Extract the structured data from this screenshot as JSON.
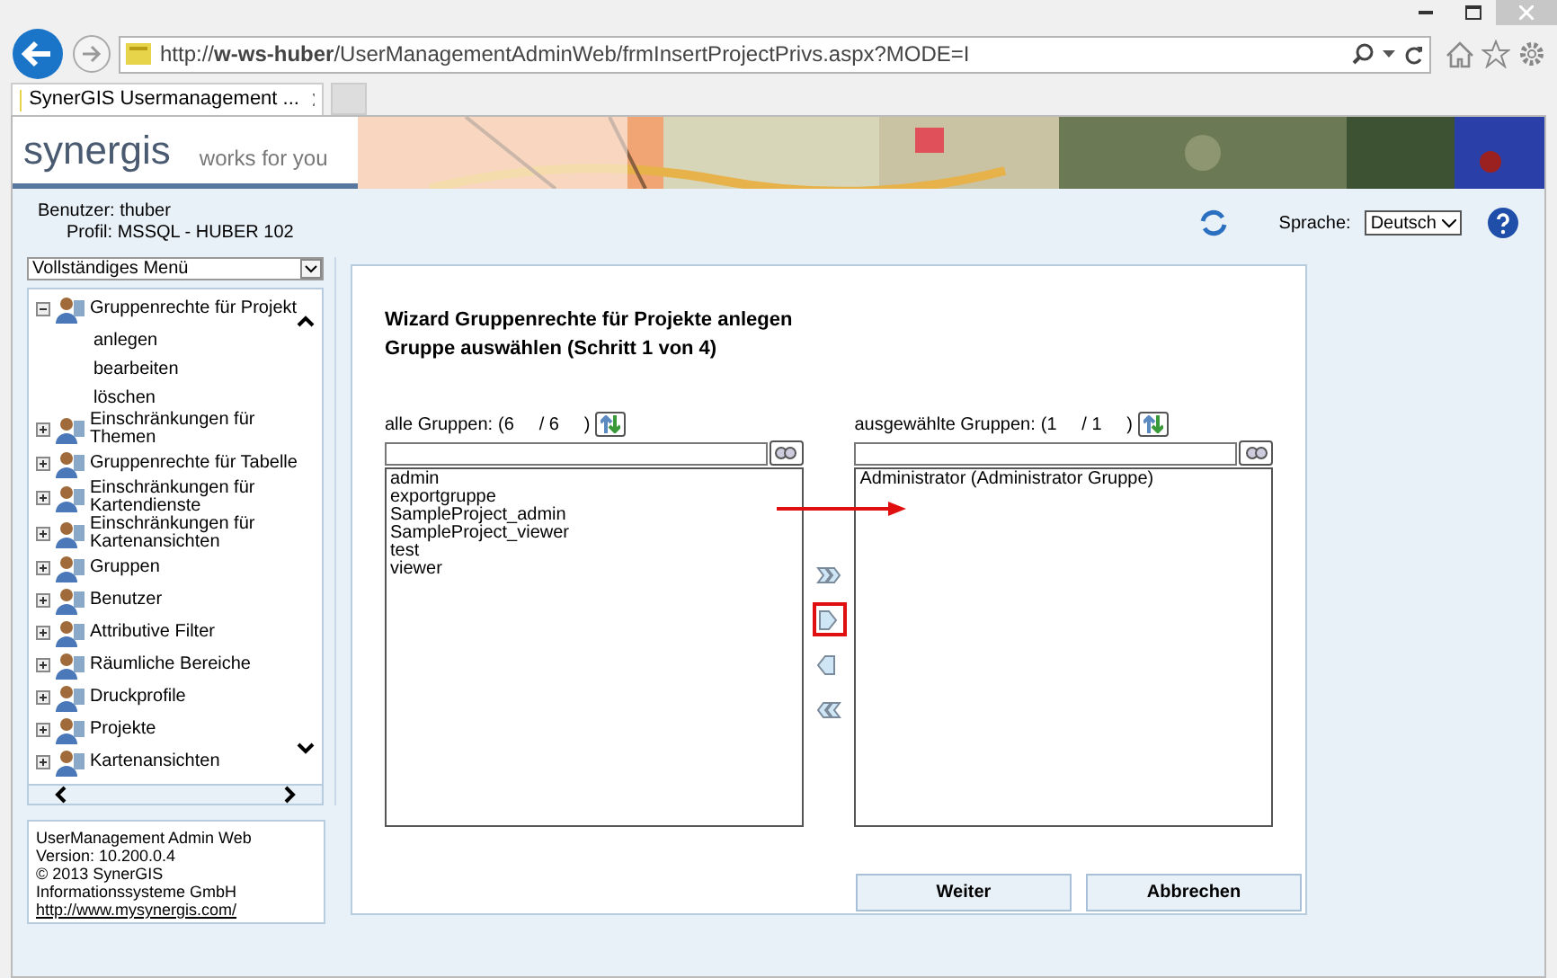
{
  "browser": {
    "url": "http://**w-ws-huber**/UserManagementAdminWeb/frmInsertProjectPrivs.aspx?MODE=I",
    "tab_title": "SynerGIS Usermanagement ..."
  },
  "header": {
    "logo": "synergis",
    "tagline": "works for you"
  },
  "user": {
    "user_line": "Benutzer: thuber",
    "profile_line": "Profil: MSSQL - HUBER 102"
  },
  "language": {
    "label": "Sprache:",
    "value": "Deutsch"
  },
  "menu": {
    "select": "Vollständiges Menü",
    "items": [
      {
        "label": "Gruppenrechte für Projekt",
        "expanded": true,
        "children": [
          {
            "label": "anlegen"
          },
          {
            "label": "bearbeiten"
          },
          {
            "label": "löschen"
          }
        ]
      },
      {
        "label": "Einschränkungen für Themen",
        "expanded": false
      },
      {
        "label": "Gruppenrechte für Tabelle",
        "expanded": false
      },
      {
        "label": "Einschränkungen für Kartendienste",
        "expanded": false
      },
      {
        "label": "Einschränkungen für Kartenansichten",
        "expanded": false
      },
      {
        "label": "Gruppen",
        "expanded": false
      },
      {
        "label": "Benutzer",
        "expanded": false
      },
      {
        "label": "Attributive Filter",
        "expanded": false
      },
      {
        "label": "Räumliche Bereiche",
        "expanded": false
      },
      {
        "label": "Druckprofile",
        "expanded": false
      },
      {
        "label": "Projekte",
        "expanded": false
      },
      {
        "label": "Kartenansichten",
        "expanded": false
      }
    ]
  },
  "about": {
    "lines": [
      "UserManagement Admin Web",
      "Version: 10.200.0.4",
      "© 2013 SynerGIS",
      "Informationssysteme GmbH"
    ],
    "link": "http://www.mysynergis.com/"
  },
  "wizard": {
    "title": "Wizard Gruppenrechte für Projekte anlegen",
    "subtitle": "Gruppe auswählen (Schritt 1 von 4)",
    "lists": [
      {
        "label": "alle Gruppen:",
        "count": "(6     / 6     )",
        "items": [
          "admin",
          "exportgruppe",
          "SampleProject_admin",
          "SampleProject_viewer",
          "test",
          "viewer"
        ]
      },
      {
        "label": "ausgewählte Gruppen:",
        "count": "(1     / 1     )",
        "items": [
          "Administrator (Administrator Gruppe)"
        ]
      }
    ],
    "move_buttons": [
      {
        "kind": "all_right",
        "highlighted": false
      },
      {
        "kind": "right",
        "highlighted": true
      },
      {
        "kind": "left",
        "highlighted": false
      },
      {
        "kind": "all_left",
        "highlighted": false
      }
    ],
    "buttons": [
      "Weiter",
      "Abbrechen"
    ]
  }
}
